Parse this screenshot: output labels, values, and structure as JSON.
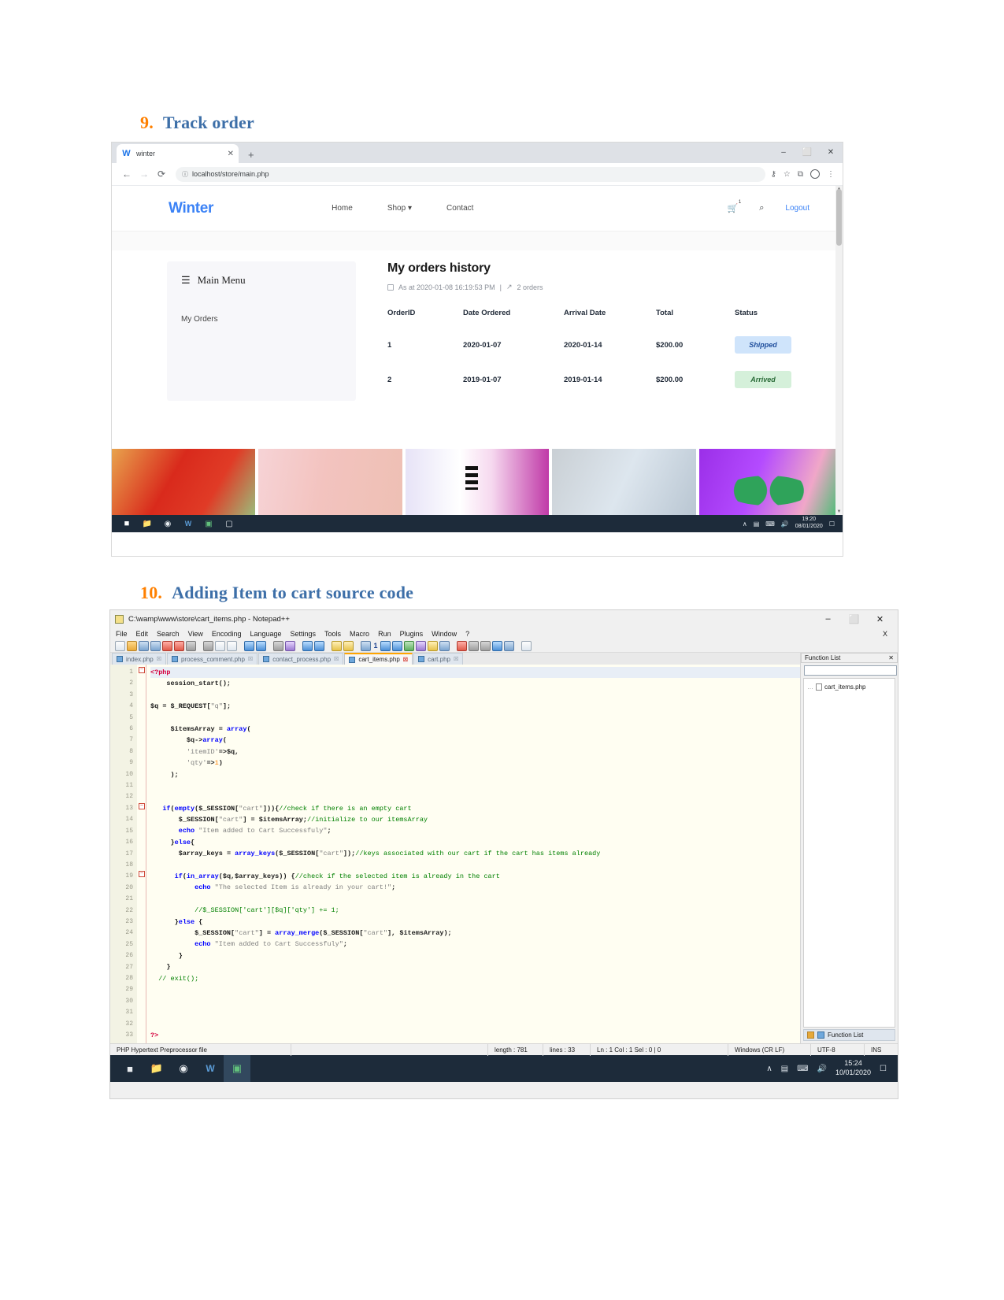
{
  "document": {
    "section9": {
      "number": "9.",
      "title": "Track order"
    },
    "section10": {
      "number": "10.",
      "title": "Adding Item to cart source code"
    }
  },
  "browser": {
    "tab": {
      "title": "winter",
      "favicon_letter": "W",
      "close": "✕"
    },
    "new_tab": "+",
    "window_controls": {
      "minimize": "‒",
      "maximize": "⬜",
      "close": "✕"
    },
    "nav": {
      "back": "←",
      "forward": "→",
      "reload": "⟳"
    },
    "address": {
      "url": "localhost/store/main.php",
      "info_icon": "ⓘ"
    },
    "toolbar_icons": {
      "key": "⚷",
      "star": "☆",
      "puzzle": "⧉",
      "profile": "avatar",
      "menu": "⋮"
    }
  },
  "site": {
    "brand": "Winter",
    "nav_links": [
      "Home",
      "Shop ▾",
      "Contact"
    ],
    "cart_icon": "Ὥ2",
    "cart_count": "1",
    "search_icon": "⌕",
    "logout": "Logout",
    "sidebar": {
      "menu_title": "Main  Menu",
      "burger": "☰",
      "items": [
        "My Orders"
      ]
    },
    "orders": {
      "heading": "My orders history",
      "meta_date": "As at 2020-01-08 16:19:53 PM",
      "meta_sep": "|",
      "meta_count": "2 orders",
      "trend_icon": "↗",
      "columns": [
        "OrderID",
        "Date Ordered",
        "Arrival Date",
        "Total",
        "Status"
      ],
      "rows": [
        {
          "id": "1",
          "date_ordered": "2020-01-07",
          "arrival_date": "2020-01-14",
          "total": "$200.00",
          "status": "Shipped",
          "status_kind": "shipped"
        },
        {
          "id": "2",
          "date_ordered": "2019-01-07",
          "arrival_date": "2019-01-14",
          "total": "$200.00",
          "status": "Arrived",
          "status_kind": "arrived"
        }
      ]
    }
  },
  "taskbar1": {
    "clock_time": "19:20",
    "clock_date": "08/01/2020",
    "tray": [
      "∧",
      "▤",
      "⌨",
      "🔊"
    ]
  },
  "notepad": {
    "title": "C:\\wamp\\www\\store\\cart_items.php - Notepad++",
    "window_controls": {
      "minimize": "‒",
      "maximize": "⬜",
      "close": "✕"
    },
    "menu": [
      "File",
      "Edit",
      "Search",
      "View",
      "Encoding",
      "Language",
      "Settings",
      "Tools",
      "Macro",
      "Run",
      "Plugins",
      "Window",
      "?"
    ],
    "menu_close": "X",
    "tabs": [
      {
        "label": "index.php",
        "active": false
      },
      {
        "label": "process_comment.php",
        "active": false
      },
      {
        "label": "contact_process.php",
        "active": false
      },
      {
        "label": "cart_items.php",
        "active": true
      },
      {
        "label": "cart.php",
        "active": false
      }
    ],
    "function_list": {
      "title": "Function List",
      "close": "✕",
      "search_placeholder": "",
      "sort_icon": "A↓",
      "reload_icon": "⟳",
      "items": [
        "cart_items.php"
      ],
      "footer_label": "Function List"
    },
    "status": {
      "doc_type": "PHP Hypertext Preprocessor file",
      "length_label": "length : 781",
      "lines_label": "lines : 33",
      "position": "Ln : 1   Col : 1   Sel : 0 | 0",
      "eol": "Windows (CR LF)",
      "encoding": "UTF-8",
      "insert_mode": "INS"
    },
    "code_lines": [
      {
        "n": 1,
        "fold": "minus",
        "html": "<span class=\"php\">&lt;?php</span>"
      },
      {
        "n": 2,
        "html": "    <span class=\"var\">session_start</span><span class=\"op\">();</span>"
      },
      {
        "n": 3,
        "html": ""
      },
      {
        "n": 4,
        "html": "<span class=\"var\">$q</span> <span class=\"op\">=</span> <span class=\"var\">$_REQUEST</span><span class=\"op\">[</span><span class=\"str\">\"q\"</span><span class=\"op\">];</span>"
      },
      {
        "n": 5,
        "html": ""
      },
      {
        "n": 6,
        "html": "     <span class=\"var\">$itemsArray</span> <span class=\"op\">=</span> <span class=\"kw\">array</span><span class=\"op\">(</span>"
      },
      {
        "n": 7,
        "html": "         <span class=\"var\">$q</span><span class=\"op\">-&gt;</span><span class=\"kw\">array</span><span class=\"op\">(</span>"
      },
      {
        "n": 8,
        "html": "         <span class=\"str\">'itemID'</span><span class=\"op\">=&gt;</span><span class=\"var\">$q</span><span class=\"op\">,</span>"
      },
      {
        "n": 9,
        "html": "         <span class=\"str\">'qty'</span><span class=\"op\">=&gt;</span><span class=\"num\">1</span><span class=\"op\">)</span>"
      },
      {
        "n": 10,
        "html": "     <span class=\"op\">);</span>"
      },
      {
        "n": 11,
        "html": ""
      },
      {
        "n": 12,
        "html": ""
      },
      {
        "n": 13,
        "fold": "minus",
        "html": "   <span class=\"kw\">if</span><span class=\"op\">(</span><span class=\"kw\">empty</span><span class=\"op\">(</span><span class=\"var\">$_SESSION</span><span class=\"op\">[</span><span class=\"str\">\"cart\"</span><span class=\"op\">])){</span><span class=\"cmt\">//check if there is an empty cart</span>"
      },
      {
        "n": 14,
        "html": "       <span class=\"var\">$_SESSION</span><span class=\"op\">[</span><span class=\"str\">\"cart\"</span><span class=\"op\">] =</span> <span class=\"var\">$itemsArray</span><span class=\"op\">;</span><span class=\"cmt\">//initialize to our itemsArray</span>"
      },
      {
        "n": 15,
        "html": "       <span class=\"kw\">echo</span> <span class=\"str\">\"Item added to Cart Successfuly\"</span><span class=\"op\">;</span>"
      },
      {
        "n": 16,
        "html": "     <span class=\"op\">}</span><span class=\"kw\">else</span><span class=\"op\">{</span>"
      },
      {
        "n": 17,
        "html": "       <span class=\"var\">$array_keys</span> <span class=\"op\">=</span> <span class=\"kw\">array_keys</span><span class=\"op\">(</span><span class=\"var\">$_SESSION</span><span class=\"op\">[</span><span class=\"str\">\"cart\"</span><span class=\"op\">]);</span><span class=\"cmt\">//keys associated with our cart if the cart has items already</span>"
      },
      {
        "n": 18,
        "html": ""
      },
      {
        "n": 19,
        "fold": "minus",
        "html": "      <span class=\"kw\">if</span><span class=\"op\">(</span><span class=\"kw\">in_array</span><span class=\"op\">(</span><span class=\"var\">$q</span><span class=\"op\">,</span><span class=\"var\">$array_keys</span><span class=\"op\">))</span> <span class=\"op\">{</span><span class=\"cmt\">//check if the selected item is already in the cart</span>"
      },
      {
        "n": 20,
        "html": "           <span class=\"kw\">echo</span> <span class=\"str\">\"The selected Item is already in your cart!\"</span><span class=\"op\">;</span>"
      },
      {
        "n": 21,
        "html": ""
      },
      {
        "n": 22,
        "html": "           <span class=\"cmt\">//$_SESSION['cart'][$q]['qty'] += 1;</span>"
      },
      {
        "n": 23,
        "html": "      <span class=\"op\">}</span><span class=\"kw\">else</span> <span class=\"op\">{</span>"
      },
      {
        "n": 24,
        "html": "           <span class=\"var\">$_SESSION</span><span class=\"op\">[</span><span class=\"str\">\"cart\"</span><span class=\"op\">] =</span> <span class=\"kw\">array_merge</span><span class=\"op\">(</span><span class=\"var\">$_SESSION</span><span class=\"op\">[</span><span class=\"str\">\"cart\"</span><span class=\"op\">],</span> <span class=\"var\">$itemsArray</span><span class=\"op\">);</span>"
      },
      {
        "n": 25,
        "html": "           <span class=\"kw\">echo</span> <span class=\"str\">\"Item added to Cart Successfuly\"</span><span class=\"op\">;</span>"
      },
      {
        "n": 26,
        "html": "       <span class=\"op\">}</span>"
      },
      {
        "n": 27,
        "html": "    <span class=\"op\">}</span>"
      },
      {
        "n": 28,
        "html": "  <span class=\"cmt\">// exit();</span>"
      },
      {
        "n": 29,
        "html": ""
      },
      {
        "n": 30,
        "html": ""
      },
      {
        "n": 31,
        "html": ""
      },
      {
        "n": 32,
        "html": ""
      },
      {
        "n": 33,
        "html": "<span class=\"php\">?&gt;</span>"
      }
    ]
  },
  "taskbar2": {
    "clock_time": "15:24",
    "clock_date": "10/01/2020",
    "tray": [
      "∧",
      "▤",
      "⌨",
      "🔊"
    ]
  }
}
